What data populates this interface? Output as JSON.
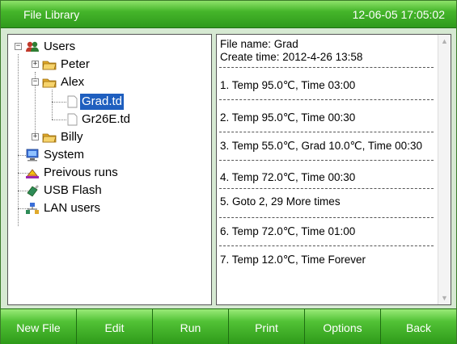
{
  "titlebar": {
    "title": "File Library",
    "datetime": "12-06-05 17:05:02"
  },
  "tree": {
    "users": "Users",
    "peter": "Peter",
    "alex": "Alex",
    "grad": "Grad.td",
    "gr26e": "Gr26E.td",
    "billy": "Billy",
    "system": "System",
    "previous_runs": "Preivous runs",
    "usb_flash": "USB Flash",
    "lan_users": "LAN users",
    "selected": "Grad.td"
  },
  "detail": {
    "file_name": "File name: Grad",
    "create_time": "Create time: 2012-4-26 13:58",
    "steps": [
      "1. Temp 95.0℃, Time 03:00",
      "2. Temp 95.0℃, Time 00:30",
      "3. Temp 55.0℃, Grad 10.0℃, Time 00:30",
      "4. Temp 72.0℃, Time 00:30",
      "5. Goto 2, 29 More times",
      "6. Temp 72.0℃, Time 01:00",
      "7. Temp 12.0℃, Time Forever"
    ]
  },
  "buttons": {
    "new_file": "New File",
    "edit": "Edit",
    "run": "Run",
    "print": "Print",
    "options": "Options",
    "back": "Back"
  },
  "colors": {
    "titlebar_green": "#45b52a",
    "button_green": "#52c236",
    "selection_blue": "#1f5fbf",
    "folder_yellow": "#f2c94c"
  }
}
